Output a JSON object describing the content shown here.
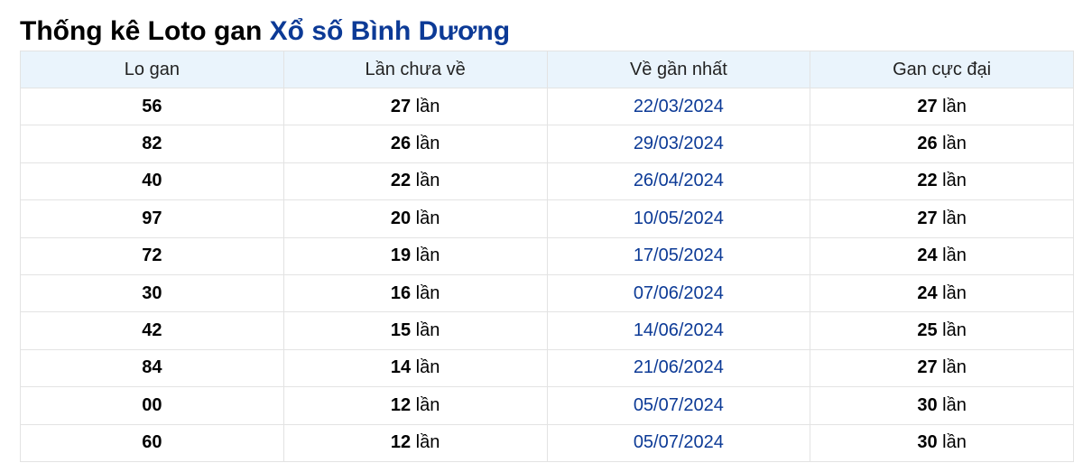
{
  "title": {
    "prefix": "Thống kê Loto gan",
    "link": "Xổ số Bình Dương"
  },
  "colors": {
    "link": "#0c3a96",
    "header_bg": "#eaf4fc",
    "border": "#e3e3e3"
  },
  "table": {
    "headers": [
      "Lo gan",
      "Lần chưa về",
      "Về gần nhất",
      "Gan cực đại"
    ],
    "unit": "lần",
    "rows": [
      {
        "lo": "56",
        "miss": "27",
        "last": "22/03/2024",
        "max": "27"
      },
      {
        "lo": "82",
        "miss": "26",
        "last": "29/03/2024",
        "max": "26"
      },
      {
        "lo": "40",
        "miss": "22",
        "last": "26/04/2024",
        "max": "22"
      },
      {
        "lo": "97",
        "miss": "20",
        "last": "10/05/2024",
        "max": "27"
      },
      {
        "lo": "72",
        "miss": "19",
        "last": "17/05/2024",
        "max": "24"
      },
      {
        "lo": "30",
        "miss": "16",
        "last": "07/06/2024",
        "max": "24"
      },
      {
        "lo": "42",
        "miss": "15",
        "last": "14/06/2024",
        "max": "25"
      },
      {
        "lo": "84",
        "miss": "14",
        "last": "21/06/2024",
        "max": "27"
      },
      {
        "lo": "00",
        "miss": "12",
        "last": "05/07/2024",
        "max": "30"
      },
      {
        "lo": "60",
        "miss": "12",
        "last": "05/07/2024",
        "max": "30"
      }
    ]
  }
}
